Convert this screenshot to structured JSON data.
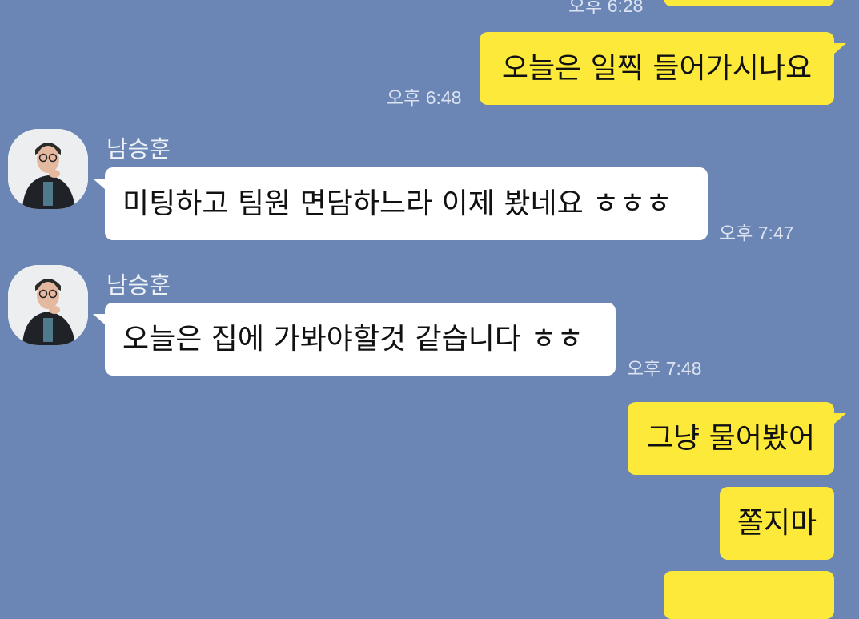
{
  "colors": {
    "background": "#6b85b5",
    "my_bubble": "#fce93a",
    "their_bubble": "#ffffff",
    "time_text": "#dde4f1"
  },
  "top_partial": {
    "time": "오후 6:28"
  },
  "messages": [
    {
      "id": "m1",
      "from": "me",
      "text": "오늘은 일찍 들어가시나요",
      "time": "오후 6:48"
    },
    {
      "id": "m2",
      "from": "other",
      "sender": "남승훈",
      "avatar_icon": "profile-photo",
      "text": "미팅하고 팀원 면담하느라 이제 봤네요 ㅎㅎㅎ",
      "time": "오후 7:47"
    },
    {
      "id": "m3",
      "from": "other",
      "sender": "남승훈",
      "avatar_icon": "profile-photo",
      "text": "오늘은 집에 가봐야할것 같습니다 ㅎㅎ",
      "time": "오후 7:48"
    },
    {
      "id": "m4",
      "from": "me",
      "text": "그냥 물어봤어"
    },
    {
      "id": "m5",
      "from": "me",
      "text": "쫄지마"
    }
  ]
}
